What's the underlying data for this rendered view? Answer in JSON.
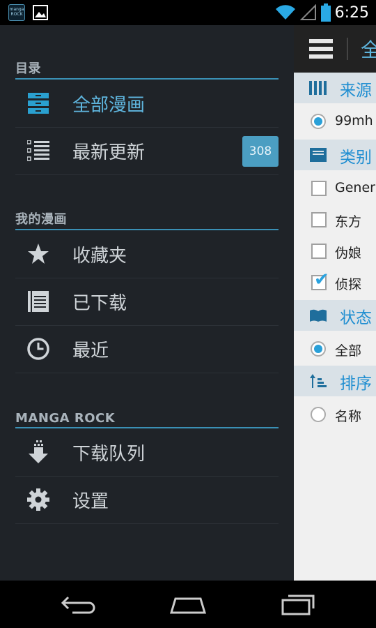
{
  "status_bar": {
    "time": "6:25",
    "app_icon_text": "manga ROCK"
  },
  "drawer": {
    "sections": [
      {
        "header": "目录",
        "items": [
          {
            "label": "全部漫画",
            "icon": "drawer-icon",
            "active": true
          },
          {
            "label": "最新更新",
            "icon": "list-icon",
            "badge": "308"
          }
        ]
      },
      {
        "header": "我的漫画",
        "items": [
          {
            "label": "收藏夹",
            "icon": "star-icon"
          },
          {
            "label": "已下载",
            "icon": "download-box-icon"
          },
          {
            "label": "最近",
            "icon": "clock-icon"
          }
        ]
      },
      {
        "header": "MANGA ROCK",
        "items": [
          {
            "label": "下载队列",
            "icon": "download-arrow-icon"
          },
          {
            "label": "设置",
            "icon": "gear-icon"
          }
        ]
      }
    ]
  },
  "content": {
    "title": "全",
    "filters": {
      "source": {
        "label": "来源",
        "options": [
          {
            "label": "99mh",
            "selected": true
          }
        ]
      },
      "category": {
        "label": "类别",
        "options": [
          {
            "label": "Generic",
            "checked": false
          },
          {
            "label": "东方",
            "checked": false
          },
          {
            "label": "伪娘",
            "checked": false
          },
          {
            "label": "侦探",
            "checked": true
          }
        ]
      },
      "status": {
        "label": "状态",
        "options": [
          {
            "label": "全部",
            "selected": true
          }
        ]
      },
      "sort": {
        "label": "排序",
        "options": [
          {
            "label": "名称",
            "selected": false
          }
        ]
      }
    }
  },
  "colors": {
    "accent": "#5fb6df",
    "drawer_bg": "#1f2328",
    "badge_bg": "#4b9ec2",
    "section_bg": "#d9e1e7"
  }
}
